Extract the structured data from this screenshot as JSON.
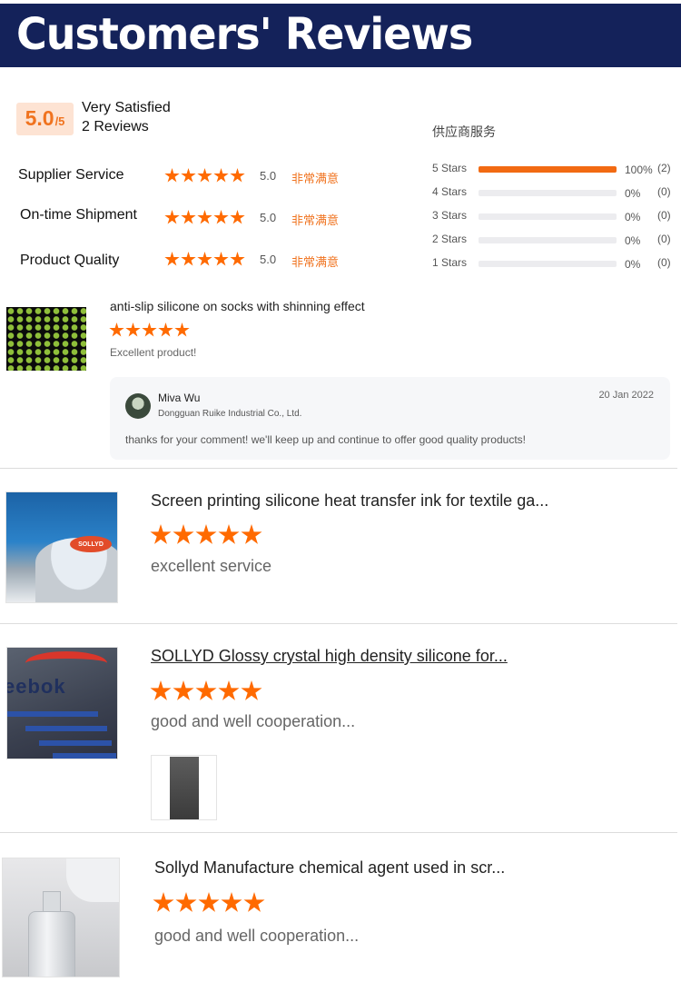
{
  "banner": {
    "title": "Customers' Reviews"
  },
  "summary": {
    "score": "5.0",
    "score_max": "/5",
    "satisfaction": "Very Satisfied",
    "review_count": "2 Reviews"
  },
  "metrics": [
    {
      "label": "Supplier Service",
      "score": "5.0",
      "rating_text": "非常满意",
      "stars": 5
    },
    {
      "label": "On-time Shipment",
      "score": "5.0",
      "rating_text": "非常满意",
      "stars": 5
    },
    {
      "label": "Product Quality",
      "score": "5.0",
      "rating_text": "非常满意",
      "stars": 5
    }
  ],
  "distribution": {
    "title": "供应商服务",
    "rows": [
      {
        "label": "5 Stars",
        "fraction": 1.0,
        "pct": "100%",
        "count": "(2)"
      },
      {
        "label": "4 Stars",
        "fraction": 0.0,
        "pct": "0%",
        "count": "(0)"
      },
      {
        "label": "3 Stars",
        "fraction": 0.0,
        "pct": "0%",
        "count": "(0)"
      },
      {
        "label": "2 Stars",
        "fraction": 0.0,
        "pct": "0%",
        "count": "(0)"
      },
      {
        "label": "1 Stars",
        "fraction": 0.0,
        "pct": "0%",
        "count": "(0)"
      }
    ]
  },
  "reviews": [
    {
      "product": "anti-slip silicone on socks with shinning effect",
      "stars": 5,
      "text": "Excellent product!",
      "reply": {
        "name": "Miva Wu",
        "company": "Dongguan Ruike Industrial Co., Ltd.",
        "date": "20 Jan 2022",
        "text": "thanks for your comment! we'll keep up and continue to offer good quality products!"
      }
    },
    {
      "product": "Screen printing silicone heat transfer ink for textile ga...",
      "stars": 5,
      "text": "excellent service",
      "thumb_logo": "SOLLYD"
    },
    {
      "product": "SOLLYD Glossy crystal high density silicone for...",
      "stars": 5,
      "text": "good and well cooperation...",
      "thumb_text": "eebok"
    },
    {
      "product": "Sollyd Manufacture chemical agent used in scr...",
      "stars": 5,
      "text": "good and well cooperation..."
    }
  ],
  "colors": {
    "banner": "#14225a",
    "accent": "#ff6a00",
    "score_bg": "#fde3d3"
  }
}
